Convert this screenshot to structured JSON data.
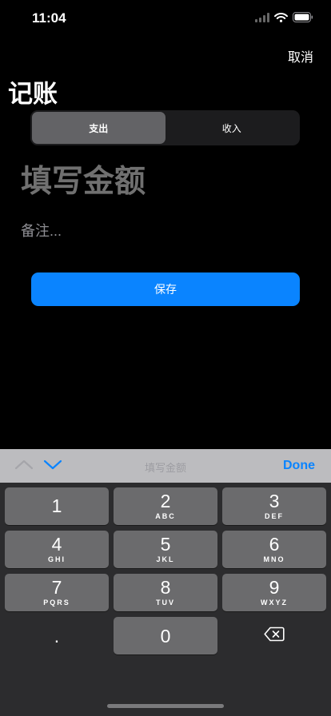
{
  "status_bar": {
    "time": "11:04"
  },
  "nav": {
    "cancel_label": "取消",
    "title": "记账"
  },
  "segment": {
    "items": [
      "支出",
      "收入"
    ],
    "selected_index": 0
  },
  "form": {
    "amount_placeholder": "填写金额",
    "note_placeholder": "备注...",
    "save_label": "保存"
  },
  "keyboard_toolbar": {
    "title": "填写金额",
    "done_label": "Done"
  },
  "keypad": {
    "keys": [
      {
        "digit": "1",
        "letters": ""
      },
      {
        "digit": "2",
        "letters": "ABC"
      },
      {
        "digit": "3",
        "letters": "DEF"
      },
      {
        "digit": "4",
        "letters": "GHI"
      },
      {
        "digit": "5",
        "letters": "JKL"
      },
      {
        "digit": "6",
        "letters": "MNO"
      },
      {
        "digit": "7",
        "letters": "PQRS"
      },
      {
        "digit": "8",
        "letters": "TUV"
      },
      {
        "digit": "9",
        "letters": "WXYZ"
      }
    ],
    "decimal": ".",
    "zero": "0"
  },
  "colors": {
    "accent": "#0a84ff",
    "background": "#000000",
    "key": "#6b6b6d",
    "keyboard_bg": "#2c2c2e",
    "toolbar_bg": "#bcbcbf"
  }
}
